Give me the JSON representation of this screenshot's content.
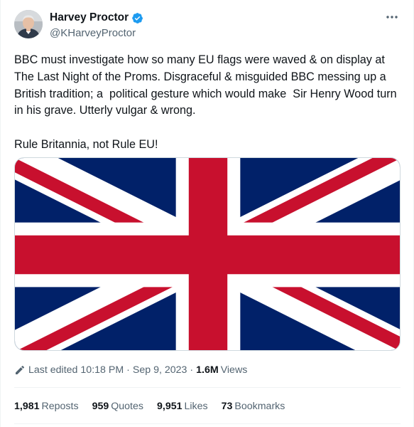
{
  "author": {
    "display_name": "Harvey Proctor",
    "handle": "@KHarveyProctor",
    "verified": true,
    "verified_color": "#1d9bf0"
  },
  "tweet": {
    "paragraphs": [
      "BBC must investigate how so many EU flags were waved & on display at The Last Night of the Proms. Disgraceful & misguided BBC messing up a British tradition; a  political gesture which would make  Sir Henry Wood turn in his grave. Utterly vulgar & wrong.",
      "Rule Britannia, not Rule EU!"
    ]
  },
  "media": {
    "icon": "union-jack-flag",
    "colors": {
      "blue": "#012169",
      "red": "#c8102e",
      "white": "#ffffff"
    }
  },
  "meta": {
    "edited_label": "Last edited",
    "time": "10:18 PM",
    "separator": "·",
    "date": "Sep 9, 2023",
    "views_count": "1.6M",
    "views_label": "Views"
  },
  "stats": {
    "reposts": {
      "count": "1,981",
      "label": "Reposts"
    },
    "quotes": {
      "count": "959",
      "label": "Quotes"
    },
    "likes": {
      "count": "9,951",
      "label": "Likes"
    },
    "bookmarks": {
      "count": "73",
      "label": "Bookmarks"
    }
  }
}
